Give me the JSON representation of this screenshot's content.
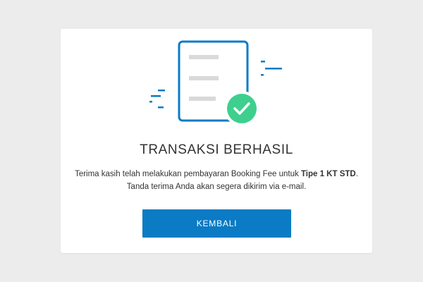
{
  "success": {
    "title": "TRANSAKSI BERHASIL",
    "message_line1_prefix": "Terima kasih telah melakukan pembayaran Booking Fee untuk ",
    "message_line1_unit": "Tipe 1 KT STD",
    "message_line1_suffix": ".",
    "message_line2": "Tanda terima Anda akan segera dikirim via e-mail."
  },
  "actions": {
    "back_label": "KEMBALI"
  },
  "colors": {
    "accent": "#0a7bc4",
    "success": "#3ecf8e",
    "document_lines": "#d9d9d9",
    "background": "#ececec"
  },
  "icons": {
    "document": "document-icon",
    "check": "checkmark-icon"
  }
}
